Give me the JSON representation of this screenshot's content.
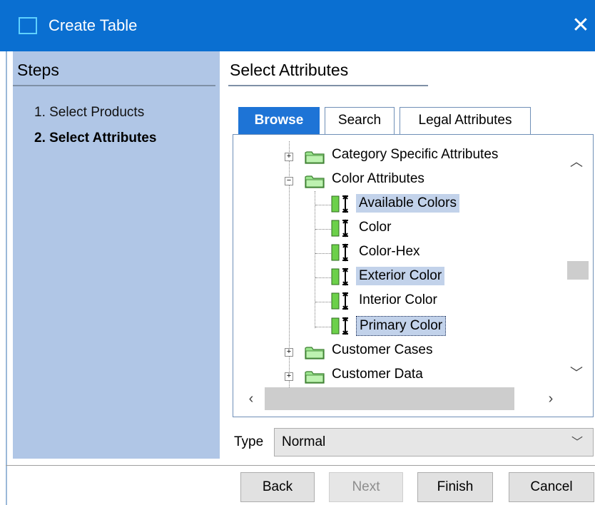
{
  "window": {
    "title": "Create Table",
    "close_glyph": "✕"
  },
  "steps": {
    "heading": "Steps",
    "items": [
      {
        "label": "1. Select Products",
        "active": false
      },
      {
        "label": "2. Select Attributes",
        "active": true
      }
    ]
  },
  "main": {
    "heading": "Select Attributes",
    "tabs": [
      {
        "label": "Browse",
        "selected": true
      },
      {
        "label": "Search",
        "selected": false
      },
      {
        "label": "Legal Attributes",
        "selected": false
      }
    ]
  },
  "tree": {
    "items": [
      {
        "label": "Category Specific Attributes",
        "type": "folder",
        "expanded": false
      },
      {
        "label": "Color Attributes",
        "type": "folder",
        "expanded": true
      },
      {
        "label": "Available Colors",
        "type": "attribute",
        "selected": true
      },
      {
        "label": "Color",
        "type": "attribute",
        "selected": false
      },
      {
        "label": "Color-Hex",
        "type": "attribute",
        "selected": false
      },
      {
        "label": "Exterior Color",
        "type": "attribute",
        "selected": true
      },
      {
        "label": "Interior Color",
        "type": "attribute",
        "selected": false
      },
      {
        "label": "Primary Color",
        "type": "attribute",
        "selected": true,
        "focused": true
      },
      {
        "label": "Customer Cases",
        "type": "folder",
        "expanded": false
      },
      {
        "label": "Customer Data",
        "type": "folder",
        "expanded": false
      }
    ]
  },
  "type_field": {
    "label": "Type",
    "value": "Normal"
  },
  "buttons": {
    "back": "Back",
    "next": "Next",
    "finish": "Finish",
    "cancel": "Cancel"
  },
  "colors": {
    "titlebar": "#0a6fd1",
    "steps_panel": "#b0c6e6",
    "selected_tab": "#1e74d6",
    "selection": "#c2d2ea"
  }
}
